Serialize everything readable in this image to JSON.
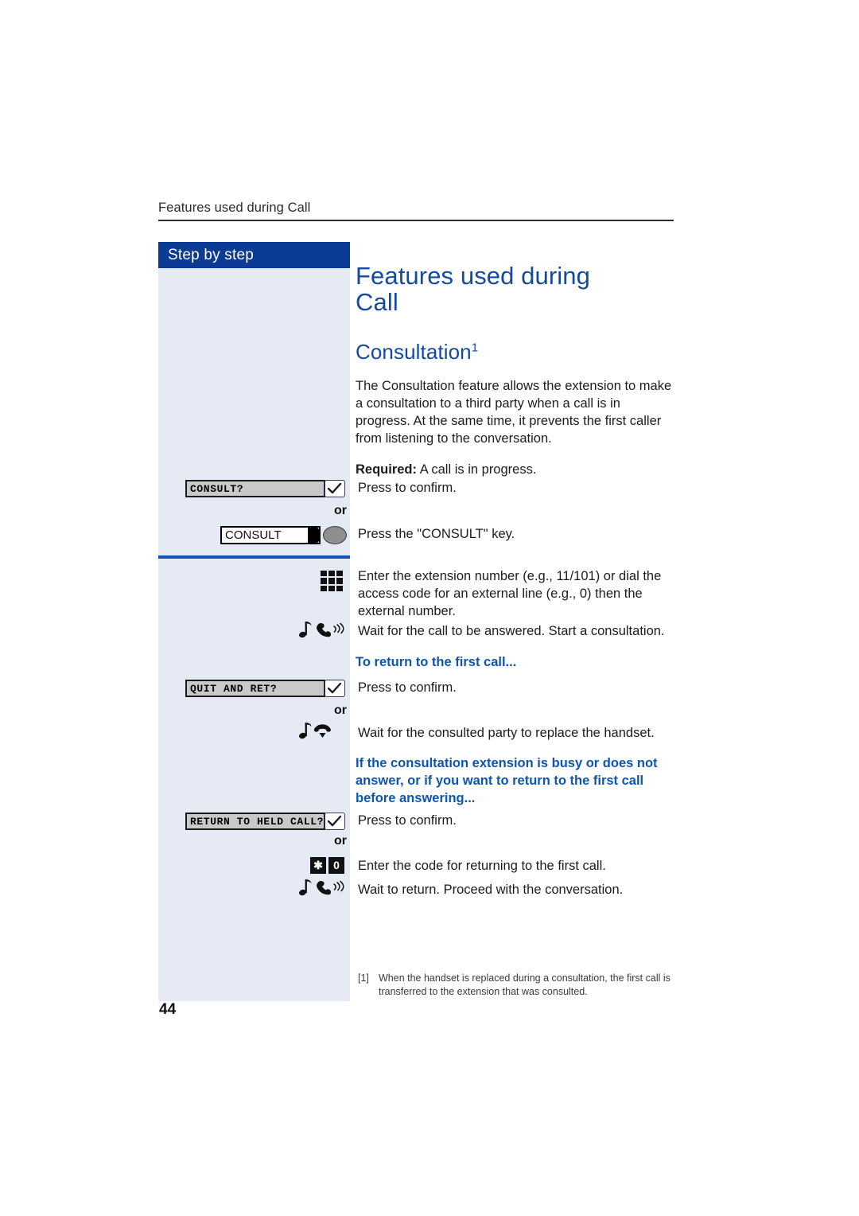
{
  "running_header": "Features used during Call",
  "sidebar": {
    "title": "Step by step"
  },
  "main": {
    "doc_title_line1": "Features used during",
    "doc_title_line2": "Call",
    "section_title": "Consultation",
    "section_title_footnote_mark": "1",
    "intro_paragraph": "The Consultation feature allows the extension to make a consultation to a third party when a call is in progress. At the same time, it prevents the first caller from listening to the conversation.",
    "required_label": "Required:",
    "required_text": " A call is in progress.",
    "subheading_return_first_call": "To return to the first call...",
    "subheading_busy_no_answer": "If the consultation extension is busy or does not answer, or if you want to return to the first call before answering..."
  },
  "steps": [
    {
      "display_field": "CONSULT?",
      "confirm_icon": "checkmark-icon",
      "text": "Press to confirm."
    },
    {
      "or_label": "or",
      "named_key": "CONSULT",
      "key_icon": "oval-key-icon",
      "text": "Press the \"CONSULT\" key."
    },
    {
      "icon": "keypad-icon",
      "text": "Enter the extension number (e.g., 11/101) or dial the access code for an external line (e.g., 0) then the external number."
    },
    {
      "icon": "tone-handset-offhook-icon",
      "text": "Wait for the call to be answered. Start a consultation."
    },
    {
      "display_field": "QUIT AND RET?",
      "confirm_icon": "checkmark-icon",
      "text": "Press to confirm."
    },
    {
      "or_label": "or",
      "icon": "tone-handset-onhook-icon",
      "text": "Wait for the consulted party to replace the handset."
    },
    {
      "display_field": "RETURN TO HELD CALL?",
      "confirm_icon": "checkmark-icon",
      "text": "Press to confirm."
    },
    {
      "or_label": "or",
      "key_star": "✱",
      "key_zero": "0",
      "text": "Enter the code for returning to the first call."
    },
    {
      "icon": "tone-handset-offhook-icon",
      "text": "Wait to return. Proceed with the conversation."
    }
  ],
  "footnote": {
    "mark": "[1]",
    "text": "When the handset is replaced during a consultation, the first call is transferred to the extension that was consulted."
  },
  "page_number": "44",
  "colors": {
    "brand_blue": "#0c3b96",
    "heading_blue": "#134a9e",
    "sidebar_bg": "#e5eaf4",
    "divider_blue": "#1452b8",
    "lcd_gray": "#c9c9c9"
  }
}
